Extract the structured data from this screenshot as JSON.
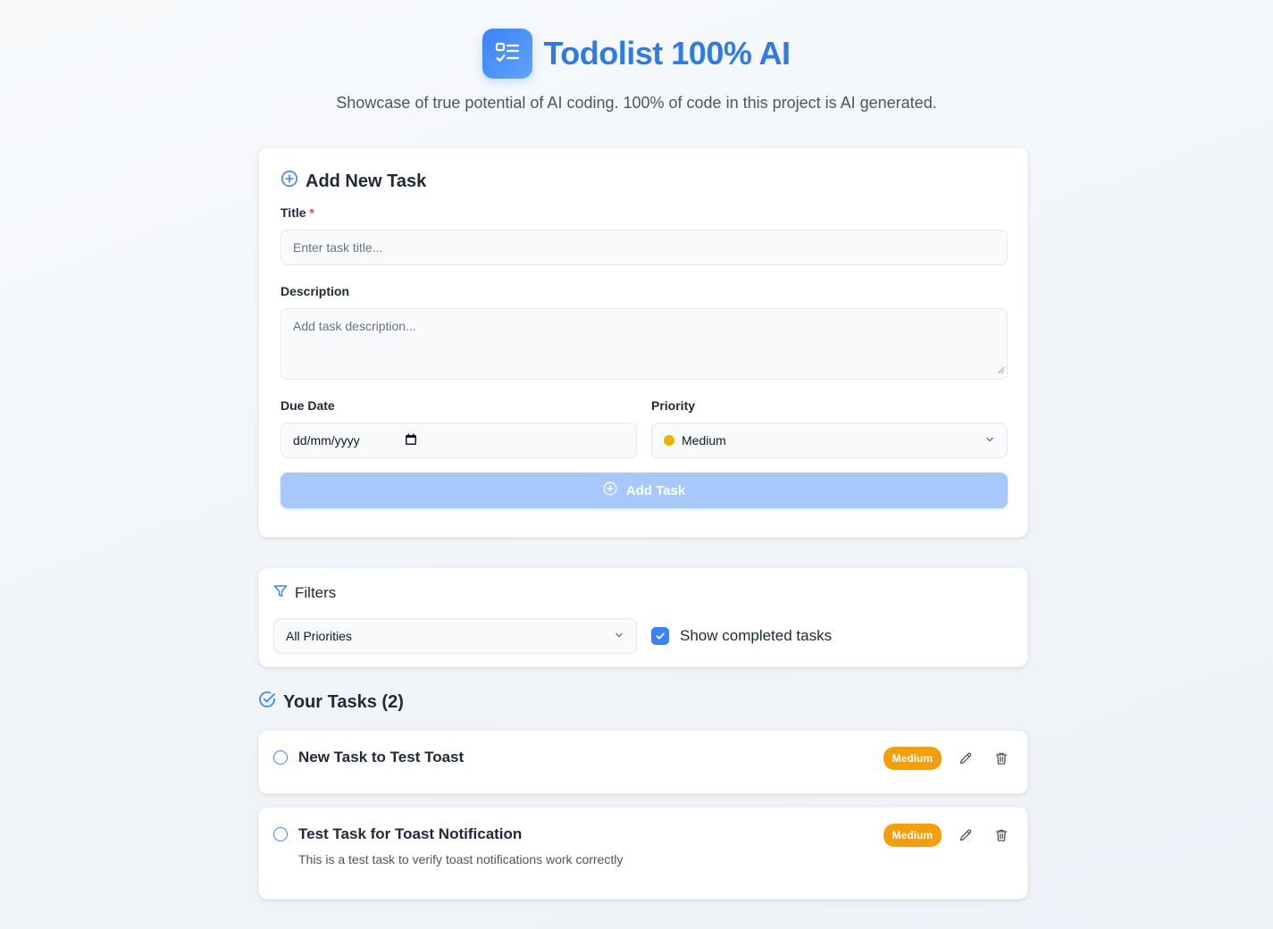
{
  "header": {
    "title": "Todolist 100% AI",
    "subtitle": "Showcase of true potential of AI coding. 100% of code in this project is AI generated."
  },
  "add_form": {
    "heading": "Add New Task",
    "title_label": "Title",
    "required_mark": "*",
    "title_placeholder": "Enter task title...",
    "description_label": "Description",
    "description_placeholder": "Add task description...",
    "due_date_label": "Due Date",
    "due_date_value": "dd/mm/yyyy",
    "priority_label": "Priority",
    "priority_value": "Medium",
    "submit_label": "Add Task"
  },
  "filters": {
    "heading": "Filters",
    "priority_filter": "All Priorities",
    "show_completed_label": "Show completed tasks",
    "show_completed": true
  },
  "tasks_section": {
    "heading": "Your Tasks (2)"
  },
  "tasks": [
    {
      "title": "New Task to Test Toast",
      "description": "",
      "priority": "Medium",
      "completed": false
    },
    {
      "title": "Test Task for Toast Notification",
      "description": "This is a test task to verify toast notifications work correctly",
      "priority": "Medium",
      "completed": false
    }
  ],
  "colors": {
    "accent": "#3b82f6",
    "title_blue": "#2f7be6",
    "medium_badge": "#f59e0b",
    "medium_dot": "#eab308",
    "required": "#ef4444"
  }
}
